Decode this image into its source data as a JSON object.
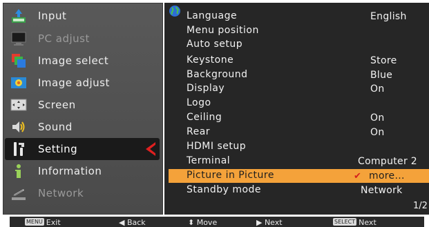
{
  "sidebar": {
    "items": [
      {
        "label": "Input",
        "icon": "input-icon",
        "dim": false
      },
      {
        "label": "PC adjust",
        "icon": "pc-adjust-icon",
        "dim": true
      },
      {
        "label": "Image select",
        "icon": "image-select-icon",
        "dim": false
      },
      {
        "label": "Image adjust",
        "icon": "image-adjust-icon",
        "dim": false
      },
      {
        "label": "Screen",
        "icon": "screen-icon",
        "dim": false
      },
      {
        "label": "Sound",
        "icon": "sound-icon",
        "dim": false
      },
      {
        "label": "Setting",
        "icon": "setting-icon",
        "dim": false,
        "active": true
      },
      {
        "label": "Information",
        "icon": "information-icon",
        "dim": false
      },
      {
        "label": "Network",
        "icon": "network-icon",
        "dim": true
      }
    ]
  },
  "settings": {
    "rows": [
      {
        "label": "Language",
        "value": "English"
      },
      {
        "label": "Menu position",
        "value": ""
      },
      {
        "label": "Auto setup",
        "value": ""
      },
      {
        "label": "Keystone",
        "value": "Store"
      },
      {
        "label": "Background",
        "value": "Blue"
      },
      {
        "label": "Display",
        "value": "On"
      },
      {
        "label": "Logo",
        "value": ""
      },
      {
        "label": "Ceiling",
        "value": "On"
      },
      {
        "label": "Rear",
        "value": "On"
      },
      {
        "label": "HDMI setup",
        "value": ""
      },
      {
        "label": "Terminal",
        "value": "Computer 2"
      },
      {
        "label": "Picture in Picture",
        "value": "more..."
      },
      {
        "label": "Standby mode",
        "value": "Network"
      }
    ],
    "page_indicator": "1/2"
  },
  "bottombar": {
    "exit_key": "MENU",
    "exit_label": "Exit",
    "back_label": "◀ Back",
    "move_label": "⬍ Move",
    "next_label": "▶ Next",
    "select_key": "SELECT",
    "select_next_label": "Next"
  },
  "colors": {
    "panel_bg": "#262626",
    "sidebar_bg": "#545454",
    "highlight": "#f4a23a",
    "pointer": "#e02020"
  }
}
